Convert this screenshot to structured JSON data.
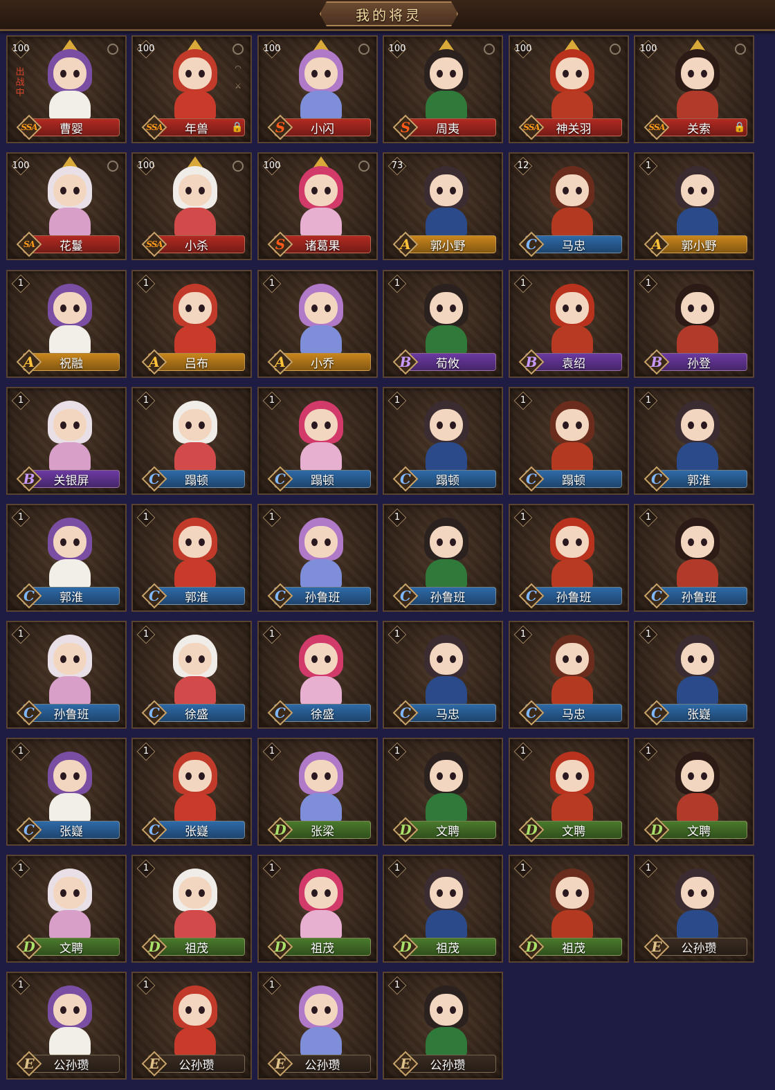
{
  "header": {
    "title": "我的将灵"
  },
  "deploy_label": "出战中",
  "colors": {
    "SSA": "#b22a22",
    "S": "#b22a22",
    "A": "#c9861c",
    "B": "#6b3aa3",
    "C": "#2e6aa8",
    "D": "#4a7a2c",
    "E": "#3a2c22",
    "letter_SSA": "#ff9a1a",
    "letter_S": "#ff5a1a",
    "letter_A": "#ffc23a",
    "letter_B": "#c89aff",
    "letter_C": "#7fb8ff",
    "letter_D": "#a9e06a",
    "letter_E": "#e0c28a"
  },
  "cards": [
    {
      "level": "100",
      "grade": "SSA",
      "name": "曹婴",
      "deploy": true,
      "corner": "c"
    },
    {
      "level": "100",
      "grade": "SSA",
      "name": "年兽",
      "lock": true,
      "corner": "c",
      "extra": true
    },
    {
      "level": "100",
      "grade": "S",
      "name": "小闪",
      "corner": "c"
    },
    {
      "level": "100",
      "grade": "S",
      "name": "周夷",
      "corner": "c"
    },
    {
      "level": "100",
      "grade": "SSA",
      "name": "神关羽",
      "corner": "c"
    },
    {
      "level": "100",
      "grade": "SSA",
      "name": "关索",
      "lock": true,
      "corner": "c"
    },
    {
      "level": "100",
      "grade": "SA",
      "name": "花鬘",
      "corner": "c"
    },
    {
      "level": "100",
      "grade": "SSA",
      "name": "小杀",
      "corner": "c"
    },
    {
      "level": "100",
      "grade": "S",
      "name": "诸葛果",
      "corner": "c"
    },
    {
      "level": "73",
      "grade": "A",
      "name": "郭小野"
    },
    {
      "level": "12",
      "grade": "C",
      "name": "马忠"
    },
    {
      "level": "1",
      "grade": "A",
      "name": "郭小野"
    },
    {
      "level": "1",
      "grade": "A",
      "name": "祝融"
    },
    {
      "level": "1",
      "grade": "A",
      "name": "吕布"
    },
    {
      "level": "1",
      "grade": "A",
      "name": "小乔"
    },
    {
      "level": "1",
      "grade": "B",
      "name": "荀攸"
    },
    {
      "level": "1",
      "grade": "B",
      "name": "袁绍"
    },
    {
      "level": "1",
      "grade": "B",
      "name": "孙登"
    },
    {
      "level": "1",
      "grade": "B",
      "name": "关银屏"
    },
    {
      "level": "1",
      "grade": "C",
      "name": "蹋顿"
    },
    {
      "level": "1",
      "grade": "C",
      "name": "蹋顿"
    },
    {
      "level": "1",
      "grade": "C",
      "name": "蹋顿"
    },
    {
      "level": "1",
      "grade": "C",
      "name": "蹋顿"
    },
    {
      "level": "1",
      "grade": "C",
      "name": "郭淮"
    },
    {
      "level": "1",
      "grade": "C",
      "name": "郭淮"
    },
    {
      "level": "1",
      "grade": "C",
      "name": "郭淮"
    },
    {
      "level": "1",
      "grade": "C",
      "name": "孙鲁班"
    },
    {
      "level": "1",
      "grade": "C",
      "name": "孙鲁班"
    },
    {
      "level": "1",
      "grade": "C",
      "name": "孙鲁班"
    },
    {
      "level": "1",
      "grade": "C",
      "name": "孙鲁班"
    },
    {
      "level": "1",
      "grade": "C",
      "name": "孙鲁班"
    },
    {
      "level": "1",
      "grade": "C",
      "name": "徐盛"
    },
    {
      "level": "1",
      "grade": "C",
      "name": "徐盛"
    },
    {
      "level": "1",
      "grade": "C",
      "name": "马忠"
    },
    {
      "level": "1",
      "grade": "C",
      "name": "马忠"
    },
    {
      "level": "1",
      "grade": "C",
      "name": "张嶷"
    },
    {
      "level": "1",
      "grade": "C",
      "name": "张嶷"
    },
    {
      "level": "1",
      "grade": "C",
      "name": "张嶷"
    },
    {
      "level": "1",
      "grade": "D",
      "name": "张梁"
    },
    {
      "level": "1",
      "grade": "D",
      "name": "文聘"
    },
    {
      "level": "1",
      "grade": "D",
      "name": "文聘"
    },
    {
      "level": "1",
      "grade": "D",
      "name": "文聘"
    },
    {
      "level": "1",
      "grade": "D",
      "name": "文聘"
    },
    {
      "level": "1",
      "grade": "D",
      "name": "祖茂"
    },
    {
      "level": "1",
      "grade": "D",
      "name": "祖茂"
    },
    {
      "level": "1",
      "grade": "D",
      "name": "祖茂"
    },
    {
      "level": "1",
      "grade": "D",
      "name": "祖茂"
    },
    {
      "level": "1",
      "grade": "E",
      "name": "公孙瓒"
    },
    {
      "level": "1",
      "grade": "E",
      "name": "公孙瓒"
    },
    {
      "level": "1",
      "grade": "E",
      "name": "公孙瓒"
    },
    {
      "level": "1",
      "grade": "E",
      "name": "公孙瓒"
    },
    {
      "level": "1",
      "grade": "E",
      "name": "公孙瓒"
    }
  ]
}
